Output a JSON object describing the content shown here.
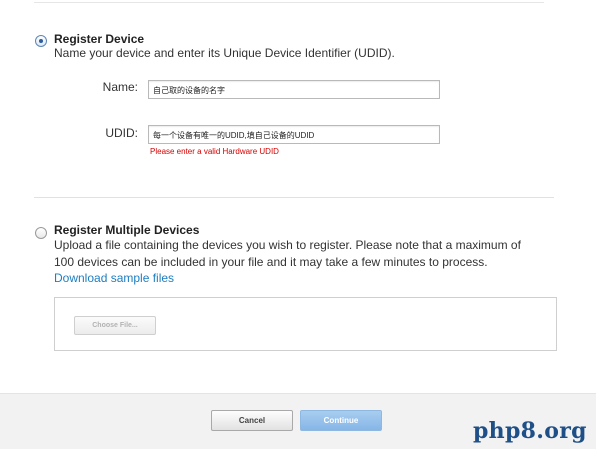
{
  "register_device": {
    "title": "Register Device",
    "description": "Name your device and enter its Unique Device Identifier (UDID).",
    "name_label": "Name:",
    "name_value": "自己取的设备的名字",
    "udid_label": "UDID:",
    "udid_value": "每一个设备有唯一的UDID,填自己设备的UDID",
    "udid_error": "Please enter a valid Hardware UDID",
    "selected": true
  },
  "register_multiple": {
    "title": "Register Multiple Devices",
    "description_line1": "Upload a file containing the devices you wish to register. Please note that a maximum of",
    "description_line2": "100 devices can be included in your file and it may take a few minutes to process.",
    "sample_link": "Download sample files",
    "choose_file_label": "Choose File...",
    "selected": false
  },
  "footer": {
    "cancel_label": "Cancel",
    "continue_label": "Continue"
  },
  "watermark": "php8.org",
  "colors": {
    "link": "#1d7ec1",
    "error": "#d60000",
    "continue_button": "#86b6e6",
    "watermark": "#1e4f86"
  }
}
